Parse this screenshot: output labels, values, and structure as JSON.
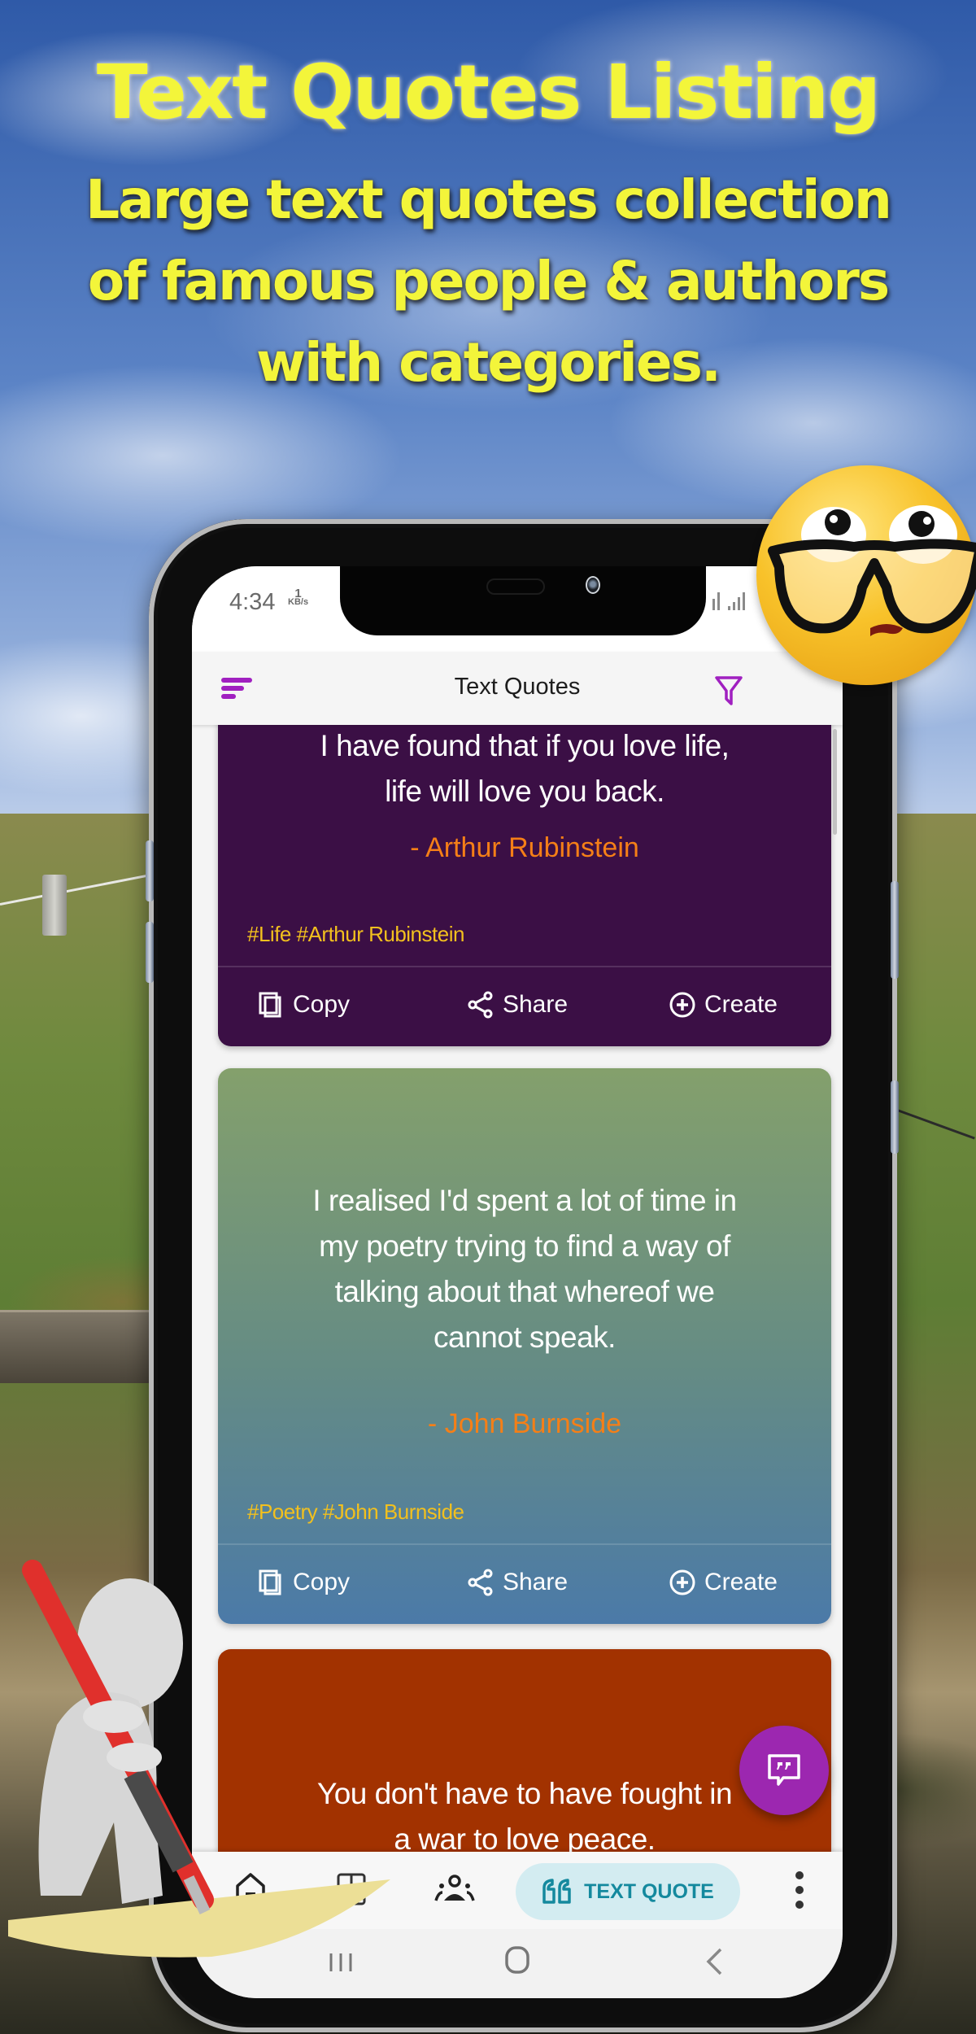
{
  "promo": {
    "title": "Text Quotes Listing",
    "subtitle_lines": [
      "Large text quotes collection",
      "of famous people & authors",
      "with categories."
    ]
  },
  "status_bar": {
    "time": "4:34",
    "net_speed_value": "1",
    "net_speed_unit": "KB/s"
  },
  "app_bar": {
    "title": "Text Quotes",
    "menu_icon": "sort-menu-icon",
    "filter_icon": "filter-icon"
  },
  "theme": {
    "accent": "#9c27b0",
    "author_color": "#f57f17",
    "tag_color": "#f2c01e",
    "chip_bg": "#d3ecf1",
    "chip_text": "#14899e"
  },
  "quotes": [
    {
      "quote_lines": [
        "I have found that if you love life,",
        "life will love you back."
      ],
      "author": "- Arthur Rubinstein",
      "tags": "#Life #Arthur Rubinstein",
      "background": "#3b0f45"
    },
    {
      "quote_lines": [
        "I realised I'd spent a lot of time in",
        "my poetry trying to find a way of",
        "talking about that whereof we",
        "cannot speak."
      ],
      "author": "- John Burnside",
      "tags": "#Poetry #John Burnside",
      "background_top": "#84a06c",
      "background_bottom": "#4b7aa8"
    },
    {
      "quote_lines": [
        "You don't have to have fought in",
        "a war to love peace."
      ],
      "background": "#a23200"
    }
  ],
  "card_actions": {
    "copy": "Copy",
    "share": "Share",
    "create": "Create"
  },
  "bottom_nav": {
    "items": [
      {
        "icon": "home-icon"
      },
      {
        "icon": "grid-icon"
      },
      {
        "icon": "people-icon"
      },
      {
        "icon": "quote-icon",
        "label": "TEXT QUOTE",
        "active": true
      },
      {
        "icon": "more-vertical-icon"
      }
    ]
  },
  "fab": {
    "icon": "quote-bubble-icon"
  },
  "system_nav": {
    "recents": "recents-icon",
    "home": "home-circle-icon",
    "back": "back-icon"
  }
}
